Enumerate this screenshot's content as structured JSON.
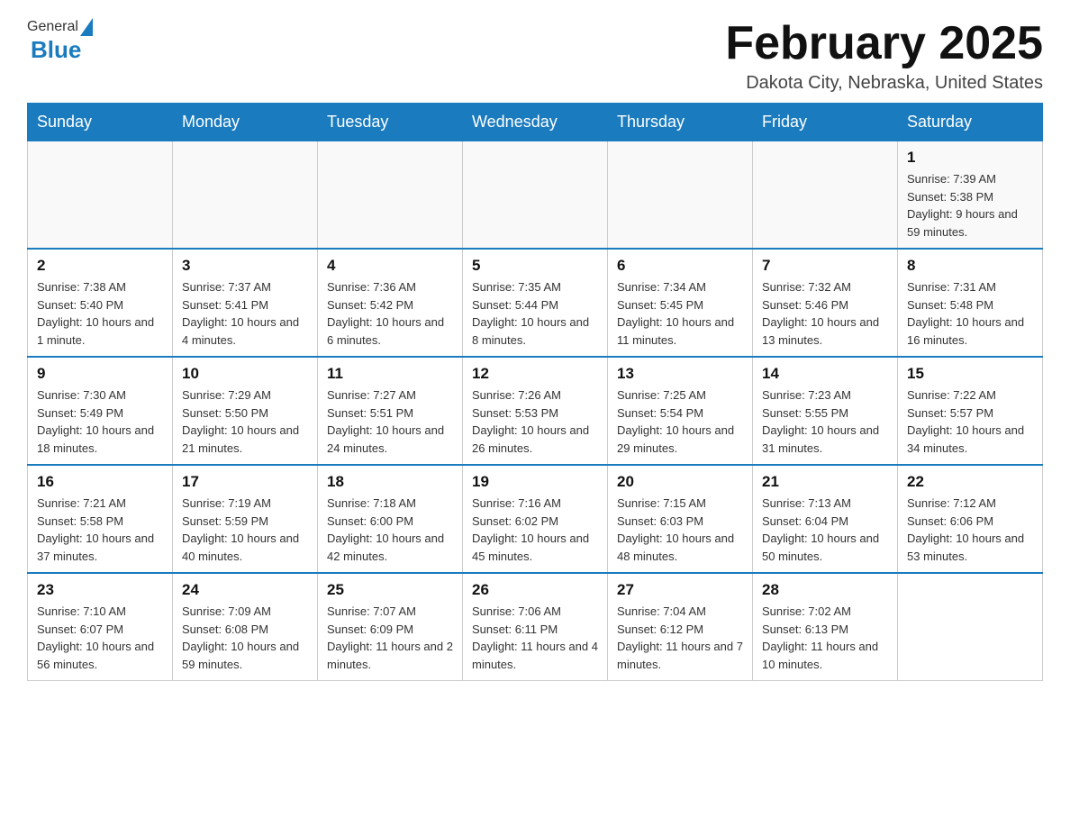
{
  "header": {
    "logo_general": "General",
    "logo_blue": "Blue",
    "title": "February 2025",
    "location": "Dakota City, Nebraska, United States"
  },
  "weekdays": [
    "Sunday",
    "Monday",
    "Tuesday",
    "Wednesday",
    "Thursday",
    "Friday",
    "Saturday"
  ],
  "weeks": [
    [
      {
        "day": "",
        "info": ""
      },
      {
        "day": "",
        "info": ""
      },
      {
        "day": "",
        "info": ""
      },
      {
        "day": "",
        "info": ""
      },
      {
        "day": "",
        "info": ""
      },
      {
        "day": "",
        "info": ""
      },
      {
        "day": "1",
        "info": "Sunrise: 7:39 AM\nSunset: 5:38 PM\nDaylight: 9 hours and 59 minutes."
      }
    ],
    [
      {
        "day": "2",
        "info": "Sunrise: 7:38 AM\nSunset: 5:40 PM\nDaylight: 10 hours and 1 minute."
      },
      {
        "day": "3",
        "info": "Sunrise: 7:37 AM\nSunset: 5:41 PM\nDaylight: 10 hours and 4 minutes."
      },
      {
        "day": "4",
        "info": "Sunrise: 7:36 AM\nSunset: 5:42 PM\nDaylight: 10 hours and 6 minutes."
      },
      {
        "day": "5",
        "info": "Sunrise: 7:35 AM\nSunset: 5:44 PM\nDaylight: 10 hours and 8 minutes."
      },
      {
        "day": "6",
        "info": "Sunrise: 7:34 AM\nSunset: 5:45 PM\nDaylight: 10 hours and 11 minutes."
      },
      {
        "day": "7",
        "info": "Sunrise: 7:32 AM\nSunset: 5:46 PM\nDaylight: 10 hours and 13 minutes."
      },
      {
        "day": "8",
        "info": "Sunrise: 7:31 AM\nSunset: 5:48 PM\nDaylight: 10 hours and 16 minutes."
      }
    ],
    [
      {
        "day": "9",
        "info": "Sunrise: 7:30 AM\nSunset: 5:49 PM\nDaylight: 10 hours and 18 minutes."
      },
      {
        "day": "10",
        "info": "Sunrise: 7:29 AM\nSunset: 5:50 PM\nDaylight: 10 hours and 21 minutes."
      },
      {
        "day": "11",
        "info": "Sunrise: 7:27 AM\nSunset: 5:51 PM\nDaylight: 10 hours and 24 minutes."
      },
      {
        "day": "12",
        "info": "Sunrise: 7:26 AM\nSunset: 5:53 PM\nDaylight: 10 hours and 26 minutes."
      },
      {
        "day": "13",
        "info": "Sunrise: 7:25 AM\nSunset: 5:54 PM\nDaylight: 10 hours and 29 minutes."
      },
      {
        "day": "14",
        "info": "Sunrise: 7:23 AM\nSunset: 5:55 PM\nDaylight: 10 hours and 31 minutes."
      },
      {
        "day": "15",
        "info": "Sunrise: 7:22 AM\nSunset: 5:57 PM\nDaylight: 10 hours and 34 minutes."
      }
    ],
    [
      {
        "day": "16",
        "info": "Sunrise: 7:21 AM\nSunset: 5:58 PM\nDaylight: 10 hours and 37 minutes."
      },
      {
        "day": "17",
        "info": "Sunrise: 7:19 AM\nSunset: 5:59 PM\nDaylight: 10 hours and 40 minutes."
      },
      {
        "day": "18",
        "info": "Sunrise: 7:18 AM\nSunset: 6:00 PM\nDaylight: 10 hours and 42 minutes."
      },
      {
        "day": "19",
        "info": "Sunrise: 7:16 AM\nSunset: 6:02 PM\nDaylight: 10 hours and 45 minutes."
      },
      {
        "day": "20",
        "info": "Sunrise: 7:15 AM\nSunset: 6:03 PM\nDaylight: 10 hours and 48 minutes."
      },
      {
        "day": "21",
        "info": "Sunrise: 7:13 AM\nSunset: 6:04 PM\nDaylight: 10 hours and 50 minutes."
      },
      {
        "day": "22",
        "info": "Sunrise: 7:12 AM\nSunset: 6:06 PM\nDaylight: 10 hours and 53 minutes."
      }
    ],
    [
      {
        "day": "23",
        "info": "Sunrise: 7:10 AM\nSunset: 6:07 PM\nDaylight: 10 hours and 56 minutes."
      },
      {
        "day": "24",
        "info": "Sunrise: 7:09 AM\nSunset: 6:08 PM\nDaylight: 10 hours and 59 minutes."
      },
      {
        "day": "25",
        "info": "Sunrise: 7:07 AM\nSunset: 6:09 PM\nDaylight: 11 hours and 2 minutes."
      },
      {
        "day": "26",
        "info": "Sunrise: 7:06 AM\nSunset: 6:11 PM\nDaylight: 11 hours and 4 minutes."
      },
      {
        "day": "27",
        "info": "Sunrise: 7:04 AM\nSunset: 6:12 PM\nDaylight: 11 hours and 7 minutes."
      },
      {
        "day": "28",
        "info": "Sunrise: 7:02 AM\nSunset: 6:13 PM\nDaylight: 11 hours and 10 minutes."
      },
      {
        "day": "",
        "info": ""
      }
    ]
  ]
}
